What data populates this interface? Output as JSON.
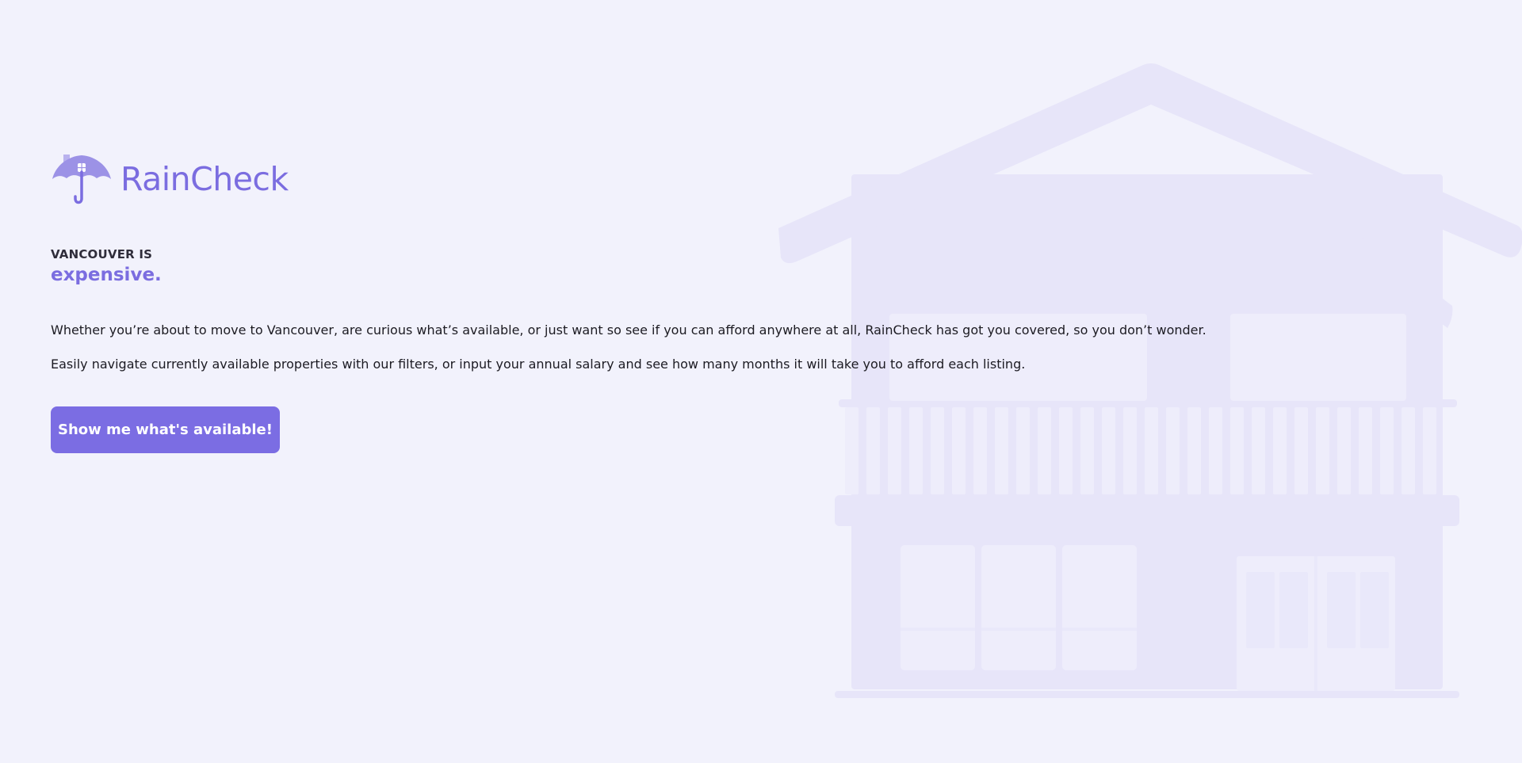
{
  "brand": {
    "name": "RainCheck",
    "logo_icon": "umbrella-house-icon"
  },
  "hero": {
    "tagline_top": "VANCOUVER IS",
    "tagline_accent": "expensive.",
    "paragraph_1": "Whether you’re about to move to Vancouver, are curious what’s available, or just want so see if you can afford anywhere at all, RainCheck has got you covered, so you don’t wonder.",
    "paragraph_2": "Easily navigate currently available properties with our filters, or input your annual salary and see how many months it will take you to afford each listing.",
    "cta_label": "Show me what's available!"
  },
  "background": {
    "illustration": "house-illustration"
  },
  "colors": {
    "accent": "#7b6de0",
    "page_bg": "#f2f2fc",
    "house_fill": "#e7e5f9"
  }
}
